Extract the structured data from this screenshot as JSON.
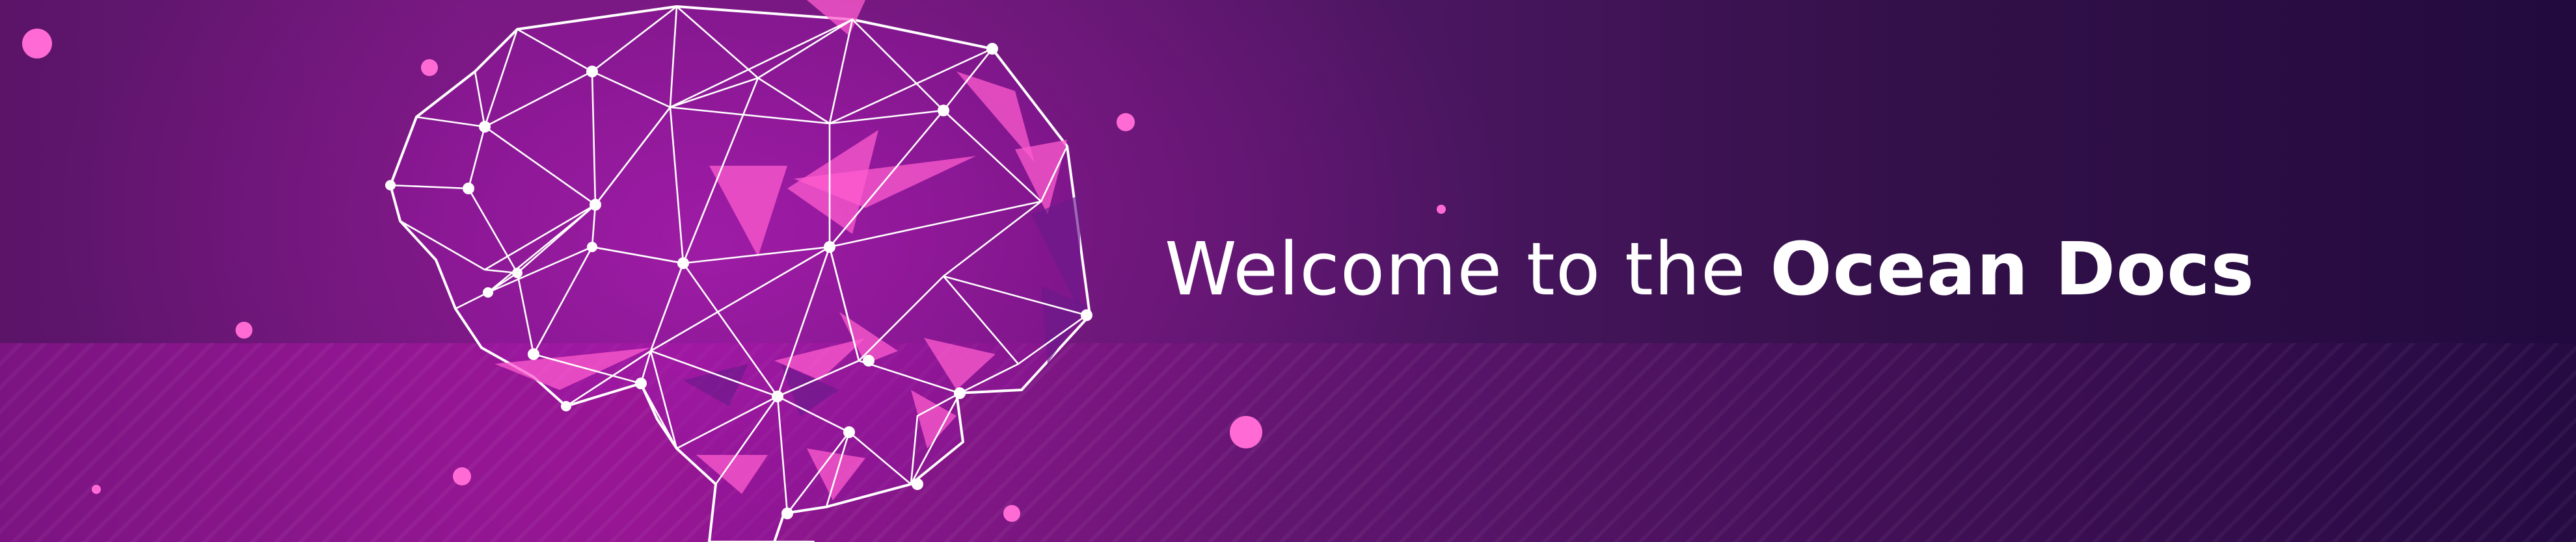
{
  "banner": {
    "headline_prefix": "Welcome to the",
    "headline_brand": "Ocean Docs"
  },
  "illustration": {
    "icon": "polygonal-brain-icon"
  },
  "colors": {
    "background_left": "#6e1a7a",
    "background_right": "#220a3e",
    "accent_pink": "#ff6ad5",
    "line_white": "#ffffff",
    "text": "#ffffff"
  }
}
